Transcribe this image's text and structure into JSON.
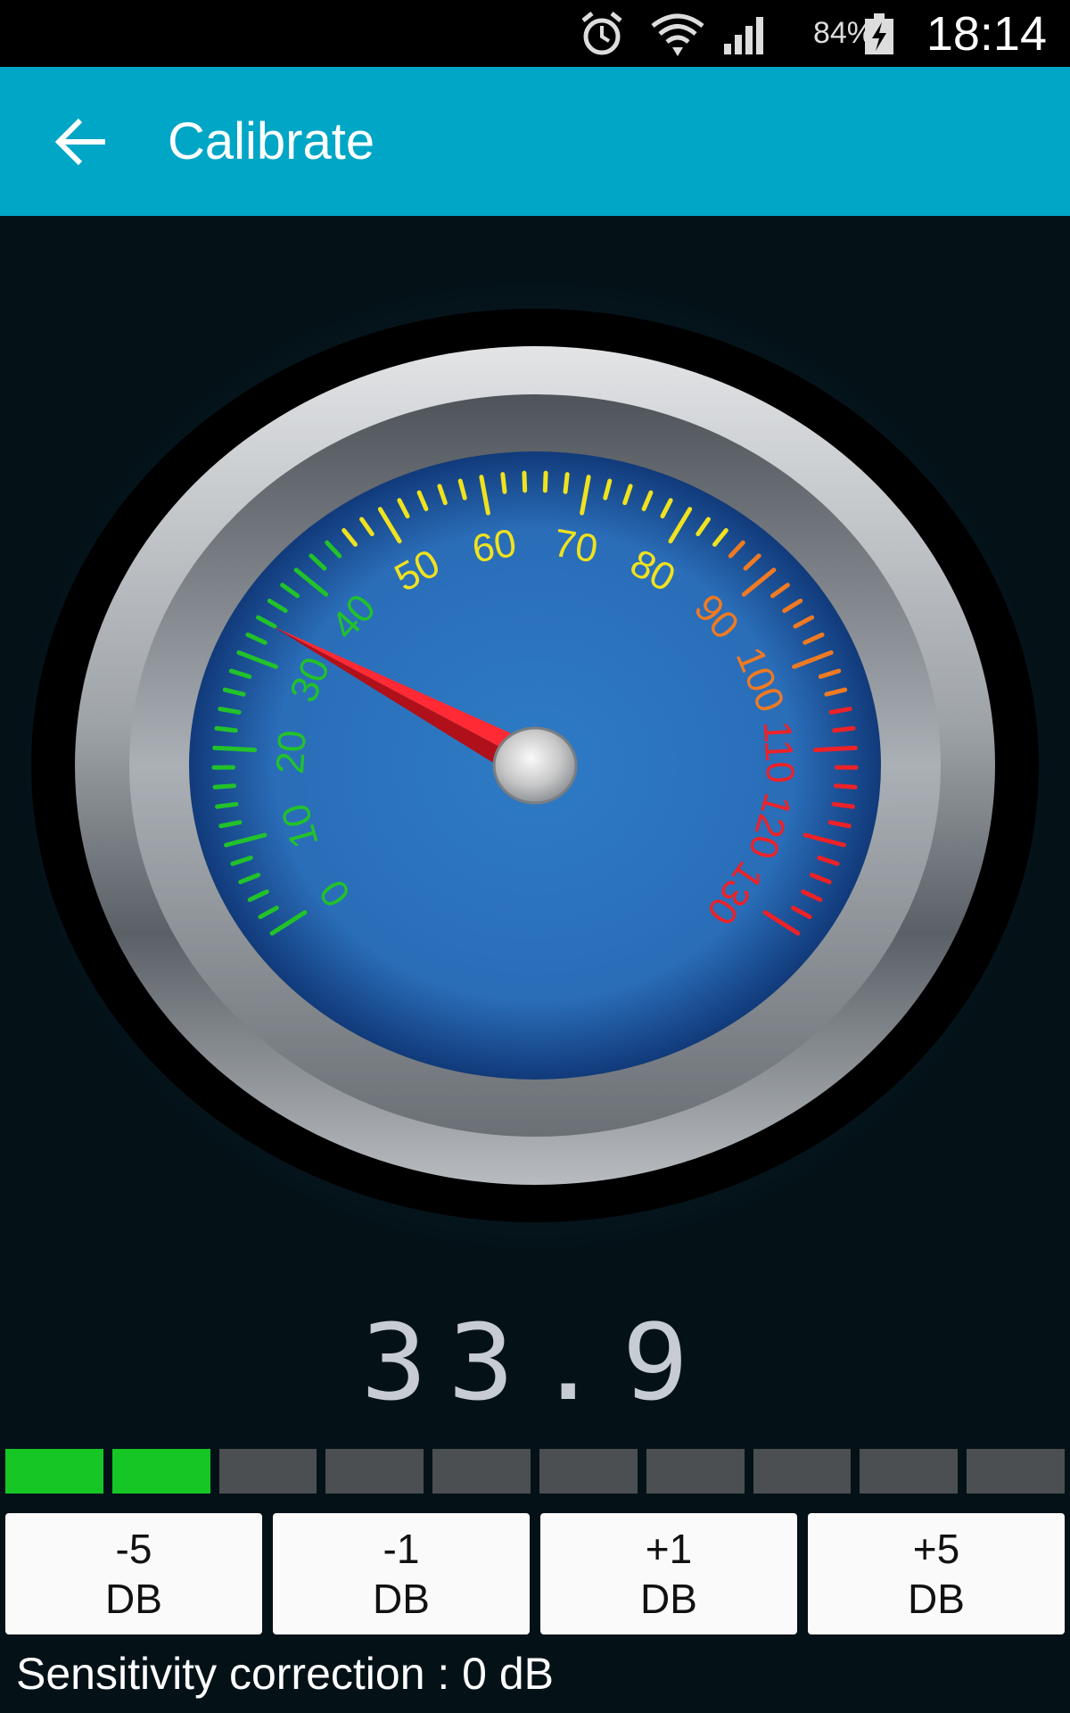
{
  "status_bar": {
    "time": "18:14",
    "battery_percent": "84%",
    "icons": [
      "alarm-icon",
      "wifi-icon",
      "signal-icon",
      "battery-charging-icon"
    ]
  },
  "app_bar": {
    "title": "Calibrate",
    "back_icon": "arrow-left-icon",
    "color": "#00a6c6"
  },
  "gauge": {
    "min": 0,
    "max": 130,
    "value": 33.9,
    "labels": [
      "0",
      "10",
      "20",
      "30",
      "40",
      "50",
      "60",
      "70",
      "80",
      "90",
      "100",
      "110",
      "120",
      "130"
    ],
    "zone_colors": {
      "green": "#22c22a",
      "yellow": "#f0e21e",
      "orange": "#f07a22",
      "red": "#ec2228"
    },
    "needle_color": "#e8121c"
  },
  "readout": {
    "value": "33.9"
  },
  "level_meter": {
    "segments": 10,
    "active": 2,
    "active_color": "#15c625",
    "inactive_color": "#4b4f52"
  },
  "buttons": [
    {
      "value": "-5",
      "unit": "DB"
    },
    {
      "value": "-1",
      "unit": "DB"
    },
    {
      "value": "+1",
      "unit": "DB"
    },
    {
      "value": "+5",
      "unit": "DB"
    }
  ],
  "sensitivity": {
    "text": "Sensitivity correction : 0 dB"
  }
}
